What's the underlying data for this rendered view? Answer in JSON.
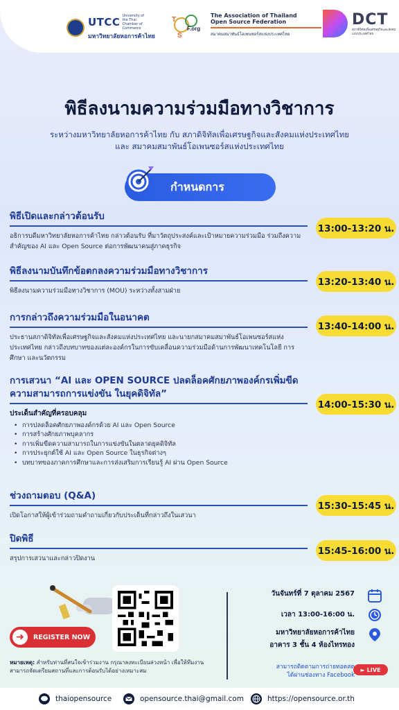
{
  "header": {
    "utcc_name": "UTCC",
    "utcc_sub": "University of the Thai Chamber of Commerce",
    "utcc_thai": "มหาวิทยาลัยหอการค้าไทย",
    "osf_mark": "OSF.org",
    "osf_line1": "The Association of Thailand",
    "osf_line2": "Open Source Federation",
    "osf_thai": "สมาคมสมาพันธ์โอเพนซอร์สแห่งประเทศไทย",
    "dct_name": "DCT",
    "dct_sub": "สภาดิจิทัลเพื่อเศรษฐกิจและสังคมแห่งประเทศไทย"
  },
  "title": "พิธีลงนามความร่วมมือทางวิชาการ",
  "subtitle_line1": "ระหว่างมหาวิทยาลัยหอการค้าไทย กับ สภาดิจิทัลเพื่อเศรษฐกิจและสังคมแห่งประเทศไทย",
  "subtitle_line2": "และ สมาคมสมาพันธ์โอเพนซอร์สแห่งประเทศไทย",
  "agenda_label": "กำหนดการ",
  "items": [
    {
      "title": "พิธีเปิดและกล่าวต้อนรับ",
      "desc": "อธิการบดีมหาวิทยาลัยหอการค้าไทย กล่าวต้อนรับ ที่มาวัตถุประสงค์และเป้าหมายความร่วมมือ ร่วมถึงความสำคัญของ AI และ Open Source ต่อการพัฒนาคนสู่ภาคธุรกิจ",
      "time": "13:00-13:20 น."
    },
    {
      "title": "พิธีลงนามบันทึกข้อตกลงความร่วมมือทางวิชาการ",
      "desc": "พิธีลงนามความร่วมมือทางวิชาการ (MOU) ระหว่างทั้งสามฝ่าย",
      "time": "13:20-13:40 น."
    },
    {
      "title": "การกล่าวถึงความร่วมมือในอนาคต",
      "desc": "ประธานสภาดิจิทัลเพื่อเศรษฐกิจและสังคมแห่งประเทศไทย และนายกสมาคมสมาพันธ์โอเพนซอร์สแห่งประเทศไทย กล่าวถึงบทบาทของแต่ละองค์กรในการขับเคลื่อนความร่วมมือด้านการพัฒนาเทคโนโลยี การศึกษา และนวัตกรรม",
      "time": "13:40-14:00 น."
    },
    {
      "title": "การเสวนา “AI และ OPEN SOURCE ปลดล็อคศักยภาพองค์กรเพิ่มขีดความสามารถการแข่งขัน ในยุคดิจิทัล”",
      "topics_head": "ประเด็นสำคัญที่ครอบคลุม",
      "topics": [
        "การปลดล็อคศักยภาพองค์กรด้วย AI และ Open Source",
        "การสร้างศักยภาพบุคลากร",
        "การเพิ่มขีดความสามารถในการแข่งขันในตลาดยุคดิจิทัล",
        "การประยุกต์ใช้ AI และ Open Source ในธุรกิจต่างๆ",
        "บทบาทของภาคการศึกษาและการส่งเสริมการเรียนรู้ AI ผ่าน Open Source"
      ],
      "time": "14:00-15:30 น."
    },
    {
      "title": "ช่วงถามตอบ (Q&A)",
      "desc": "เปิดโอกาสให้ผู้เข้าร่วมถามคำถามเกี่ยวกับประเด็นที่กล่าวถึงในเสวนา",
      "time": "15:30-15:45 น."
    },
    {
      "title": "ปิดพิธี",
      "desc": "สรุปการเสวนาและกล่าวปิดงาน",
      "time": "15:45-16:00 น."
    }
  ],
  "event": {
    "date": "วันจันทร์ที่ 7 ตุลาคม 2567",
    "time": "เวลา 13:00-16:00 น.",
    "venue_line1": "มหาวิทยาลัยหอการค้าไทย",
    "venue_line2": "อาคาร 3 ชั้น 4 ห้องไทรทอง",
    "live_line1": "สามารถติดตามการถ่ายทอดสด",
    "live_line2": "ได้ผ่านช่องทาง Facebook",
    "live_badge": "LIVE"
  },
  "register_label": "REGISTER NOW",
  "note_label": "หมายเหตุ:",
  "note_text": " สำหรับท่านที่สนใจเข้าร่วมงาน กรุณาลงทะเบียนล่วงหน้า เพื่อให้ทีมงานสามารถจัดเตรียมสถานที่และการต้อนรับได้อย่างเหมาะสม",
  "contacts": {
    "line": "thaiopensource",
    "email": "opensource.thai@gmail.com",
    "web": "https://opensource.or.th"
  },
  "colors": {
    "accent_blue": "#2b5be0",
    "time_yellow": "#f9dc33",
    "register_red": "#d93036"
  }
}
